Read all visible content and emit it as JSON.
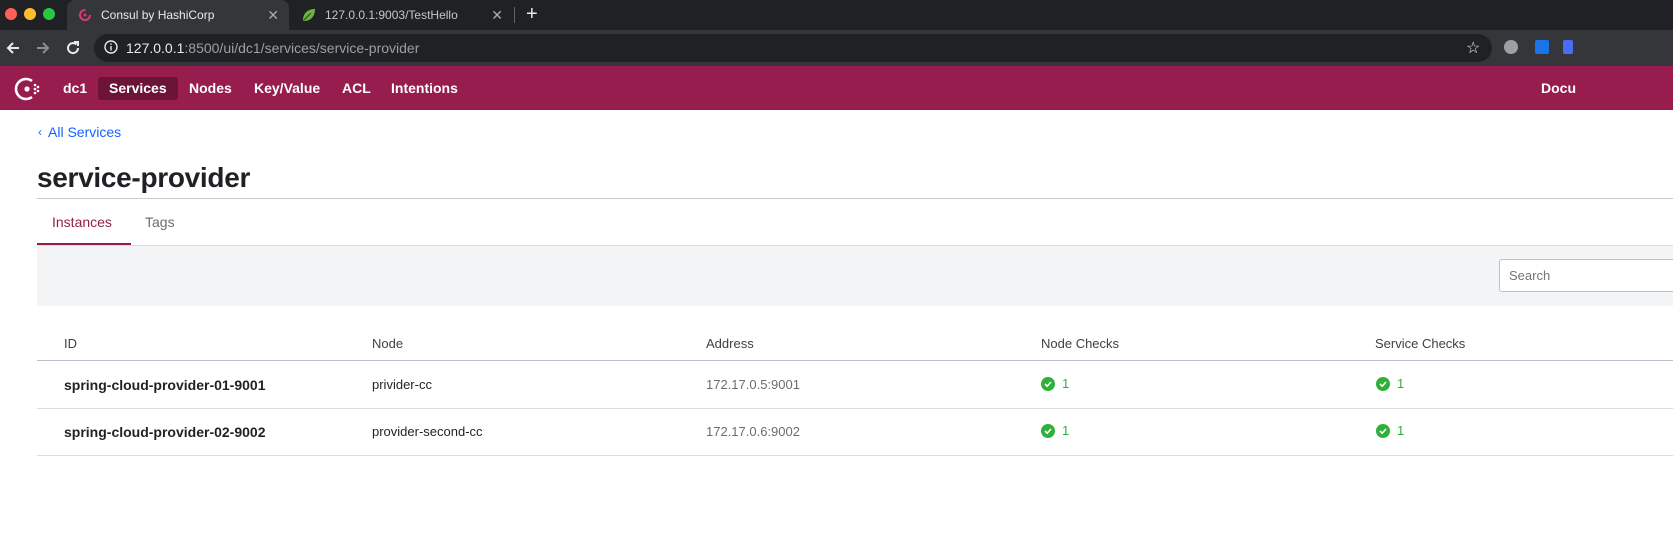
{
  "browser": {
    "tabs": [
      {
        "title": "Consul by HashiCorp",
        "active": true
      },
      {
        "title": "127.0.0.1:9003/TestHello",
        "active": false
      }
    ],
    "url_host": "127.0.0.1",
    "url_rest": ":8500/ui/dc1/services/service-provider",
    "icons": [
      "back-arrow",
      "forward-arrow",
      "reload",
      "info",
      "bookmark-star",
      "extension"
    ]
  },
  "nav": {
    "datacenter": "dc1",
    "items": [
      "Services",
      "Nodes",
      "Key/Value",
      "ACL",
      "Intentions"
    ],
    "active": "Services",
    "right_link": "Docu"
  },
  "breadcrumb": "All Services",
  "page_title": "service-provider",
  "tabs": [
    "Instances",
    "Tags"
  ],
  "active_tab": "Instances",
  "search": {
    "placeholder": "Search",
    "value": ""
  },
  "table": {
    "columns": [
      "ID",
      "Node",
      "Address",
      "Node Checks",
      "Service Checks"
    ],
    "rows": [
      {
        "id": "spring-cloud-provider-01-9001",
        "node": "privider-cc",
        "address": "172.17.0.5:9001",
        "node_checks": "1",
        "service_checks": "1"
      },
      {
        "id": "spring-cloud-provider-02-9002",
        "node": "provider-second-cc",
        "address": "172.17.0.6:9002",
        "node_checks": "1",
        "service_checks": "1"
      }
    ]
  },
  "colors": {
    "brand": "#961d4d",
    "brand_dark": "#6b1437",
    "link": "#1563ff",
    "passing": "#2eb039"
  }
}
